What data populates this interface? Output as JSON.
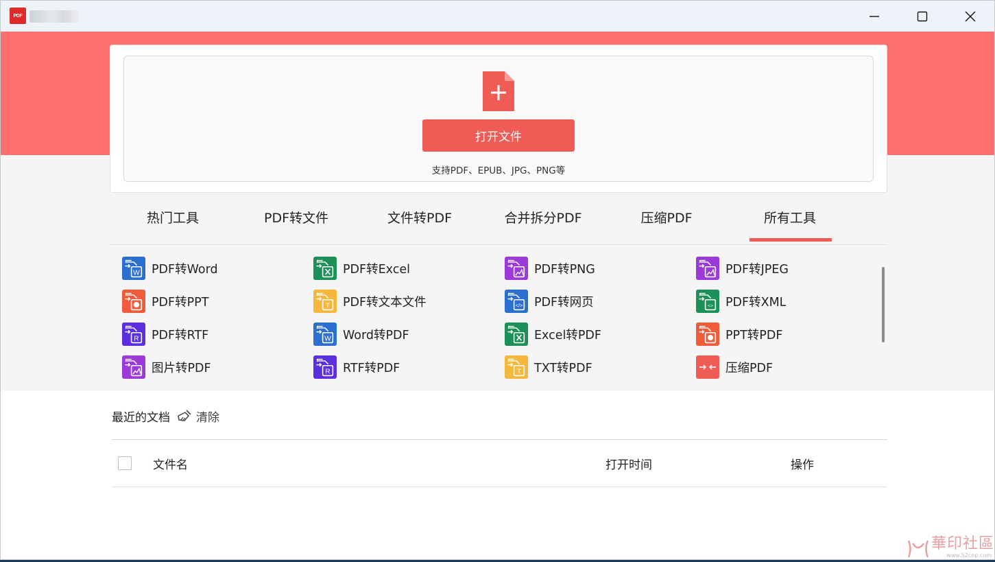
{
  "titlebar": {
    "logo_text": "PDF",
    "app_title": "",
    "controls": [
      "minimize-icon",
      "maximize-icon",
      "close-icon"
    ]
  },
  "upload": {
    "button_label": "打开文件",
    "support_text": "支持PDF、EPUB、JPG、PNG等"
  },
  "tabs": [
    {
      "label": "热门工具"
    },
    {
      "label": "PDF转文件"
    },
    {
      "label": "文件转PDF"
    },
    {
      "label": "合并拆分PDF"
    },
    {
      "label": "压缩PDF"
    },
    {
      "label": "所有工具",
      "active": true
    }
  ],
  "tools": [
    {
      "label": "PDF转Word",
      "icon": "word-convert-icon",
      "color": "#2b6fd1"
    },
    {
      "label": "PDF转Excel",
      "icon": "excel-convert-icon",
      "color": "#1b9157"
    },
    {
      "label": "PDF转PNG",
      "icon": "png-convert-icon",
      "color": "#9b3ad8"
    },
    {
      "label": "PDF转JPEG",
      "icon": "jpeg-convert-icon",
      "color": "#9b3ad8"
    },
    {
      "label": "PDF转PPT",
      "icon": "ppt-convert-icon",
      "color": "#ef5b3b"
    },
    {
      "label": "PDF转文本文件",
      "icon": "txt-convert-icon",
      "color": "#f5b83c"
    },
    {
      "label": "PDF转网页",
      "icon": "html-convert-icon",
      "color": "#2b6fd1"
    },
    {
      "label": "PDF转XML",
      "icon": "xml-convert-icon",
      "color": "#1b9157"
    },
    {
      "label": "PDF转RTF",
      "icon": "rtf-convert-icon",
      "color": "#5b2ee0"
    },
    {
      "label": "Word转PDF",
      "icon": "word-to-pdf-icon",
      "color": "#2b6fd1"
    },
    {
      "label": "Excel转PDF",
      "icon": "excel-to-pdf-icon",
      "color": "#1b9157"
    },
    {
      "label": "PPT转PDF",
      "icon": "ppt-to-pdf-icon",
      "color": "#ef5b3b"
    },
    {
      "label": "图片转PDF",
      "icon": "image-to-pdf-icon",
      "color": "#9b3ad8"
    },
    {
      "label": "RTF转PDF",
      "icon": "rtf-to-pdf-icon",
      "color": "#5b2ee0"
    },
    {
      "label": "TXT转PDF",
      "icon": "txt-to-pdf-icon",
      "color": "#f5b83c"
    },
    {
      "label": "压缩PDF",
      "icon": "compress-icon",
      "color": "#ef5b55"
    }
  ],
  "recent": {
    "title": "最近的文档",
    "clear_label": "清除"
  },
  "table": {
    "col_name": "文件名",
    "col_time": "打开时间",
    "col_action": "操作"
  },
  "watermark": {
    "main": "華印社區",
    "sub": "www.52cnp.com"
  },
  "colors": {
    "accent": "#ef5b55",
    "banner": "#ff6e6e"
  }
}
